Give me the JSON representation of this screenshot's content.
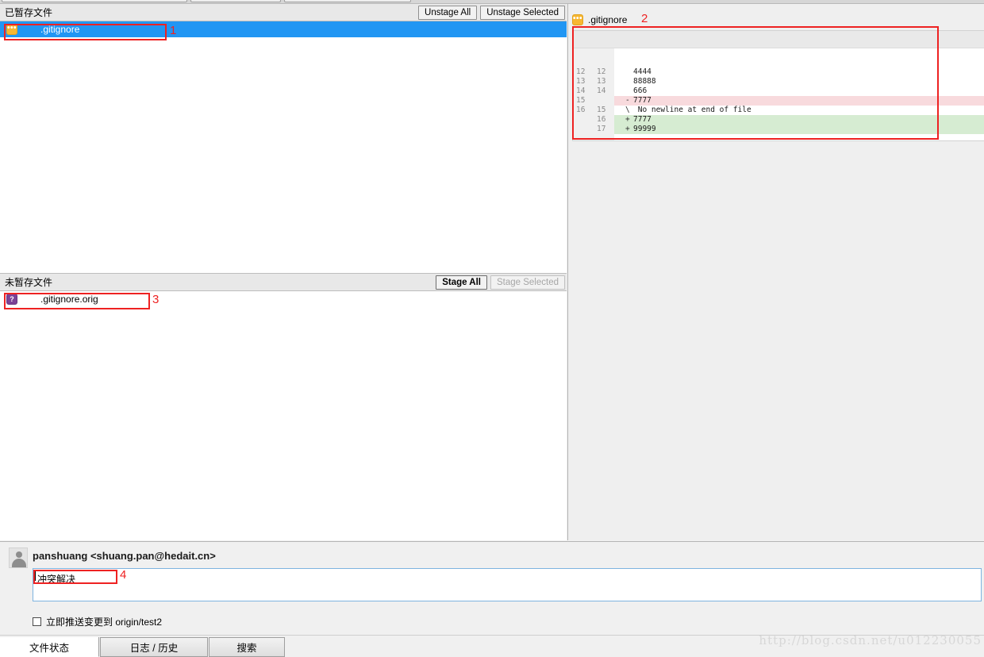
{
  "window": {
    "watermark": "http://blog.csdn.net/u012230055"
  },
  "staged_panel": {
    "title": "已暂存文件",
    "unstage_all_label": "Unstage All",
    "unstage_selected_label": "Unstage Selected",
    "files": [
      {
        "name": ".gitignore",
        "status": "modified",
        "icon": "modified-file-icon",
        "icon_glyph": "•••",
        "selected": true
      }
    ]
  },
  "unstaged_panel": {
    "title": "未暂存文件",
    "stage_all_label": "Stage All",
    "stage_selected_label": "Stage Selected",
    "stage_selected_disabled": true,
    "files": [
      {
        "name": ".gitignore.orig",
        "status": "untracked",
        "icon": "untracked-file-icon",
        "icon_glyph": "?",
        "selected": false
      }
    ]
  },
  "diff_panel": {
    "file_icon": "modified-file-icon",
    "file_name": ".gitignore",
    "rows": [
      {
        "old": "12",
        "new": "12",
        "marker": "",
        "text": "4444",
        "kind": "ctx"
      },
      {
        "old": "13",
        "new": "13",
        "marker": "",
        "text": "88888",
        "kind": "ctx"
      },
      {
        "old": "14",
        "new": "14",
        "marker": "",
        "text": "666",
        "kind": "ctx"
      },
      {
        "old": "15",
        "new": "",
        "marker": "-",
        "text": "7777",
        "kind": "del"
      },
      {
        "old": "16",
        "new": "15",
        "marker": "\\",
        "text": " No newline at end of file",
        "kind": "meta"
      },
      {
        "old": "",
        "new": "16",
        "marker": "+",
        "text": "7777",
        "kind": "add"
      },
      {
        "old": "",
        "new": "17",
        "marker": "+",
        "text": "99999",
        "kind": "add"
      }
    ]
  },
  "commit": {
    "author": "panshuang <shuang.pan@hedait.cn>",
    "message_value": "冲突解决",
    "message_placeholder": "",
    "push_checkbox_label": "立即推送变更到 origin/test2",
    "push_checked": false
  },
  "tabs": [
    {
      "label": "文件状态",
      "active": true
    },
    {
      "label": "日志 / 历史",
      "active": false
    },
    {
      "label": "搜索",
      "active": false
    }
  ],
  "annotations": [
    {
      "number": "1"
    },
    {
      "number": "2"
    },
    {
      "number": "3"
    },
    {
      "number": "4"
    }
  ],
  "colors": {
    "selection_blue": "#2196f3",
    "annotation_red": "#ee2222",
    "diff_add_bg": "#d6ecd2",
    "diff_del_bg": "#f8dadd",
    "modified_icon": "#f7b731",
    "untracked_icon": "#7b4397"
  }
}
